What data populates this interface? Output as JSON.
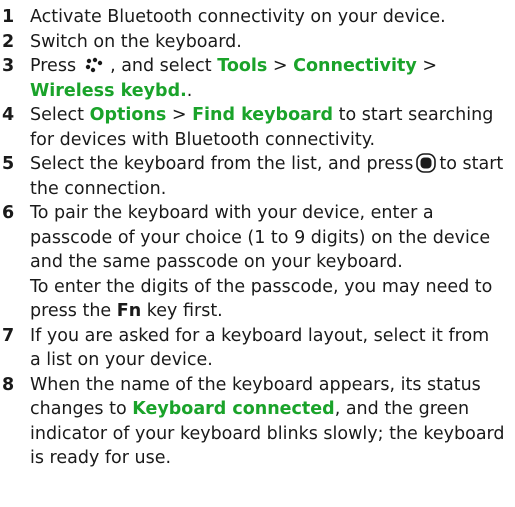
{
  "steps": [
    {
      "num": "1",
      "text": "Activate Bluetooth connectivity on your device."
    },
    {
      "num": "2",
      "text": "Switch on the keyboard."
    },
    {
      "num": "3",
      "pre": "Press",
      "post1": ", and select",
      "path1": "Tools",
      "sep": ">",
      "path2": "Connectivity",
      "path3": "Wireless keybd.",
      "end": "."
    },
    {
      "num": "4",
      "pre": "Select",
      "path1": "Options",
      "sep": ">",
      "path2": "Find keyboard",
      "post": "to start searching for devices with Bluetooth connectivity."
    },
    {
      "num": "5",
      "pre": "Select the keyboard from the list, and press",
      "post": "to start the connection."
    },
    {
      "num": "6",
      "text": "To pair the keyboard with your device, enter a passcode of your choice (1 to 9 digits) on the device and the same passcode on your keyboard.",
      "note_pre": "To enter the digits of the passcode, you may need to press the",
      "note_key": "Fn",
      "note_post": "key first."
    },
    {
      "num": "7",
      "text": "If you are asked for a keyboard layout, select it from a list on your device."
    },
    {
      "num": "8",
      "pre": "When the name of the keyboard appears, its status changes to",
      "status": "Keyboard connected",
      "post": ", and the green indicator of your keyboard blinks slowly; the keyboard is ready for use."
    }
  ],
  "icons": {
    "menu_key": "menu-key-icon",
    "select_key": "select-key-icon"
  },
  "colors": {
    "highlight": "#1aa32a",
    "text": "#1a1a1a"
  }
}
